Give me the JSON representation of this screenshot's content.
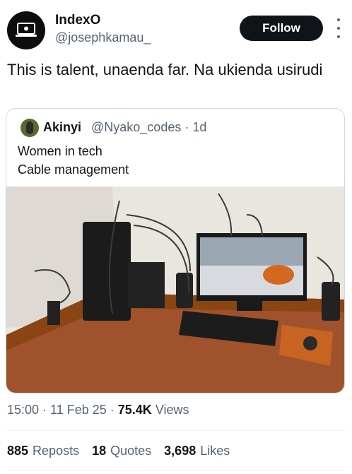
{
  "author": {
    "name": "IndexO",
    "handle": "@josephkamau_"
  },
  "follow_label": "Follow",
  "tweet_text": "This is talent, unaenda far. Na ukienda usirudi",
  "quoted": {
    "name": "Akinyi",
    "handle": "@Nyako_codes · 1d",
    "line1": "Women in tech",
    "line2": "Cable management"
  },
  "meta": {
    "time": "15:00 · 11 Feb 25 · ",
    "views_count": "75.4K",
    "views_label": " Views"
  },
  "stats": {
    "reposts_count": "885",
    "reposts_label": "Reposts",
    "quotes_count": "18",
    "quotes_label": "Quotes",
    "likes_count": "3,698",
    "likes_label": "Likes"
  },
  "icons": {
    "avatar": "laptop-logo-icon",
    "more": "more-vertical-icon"
  }
}
